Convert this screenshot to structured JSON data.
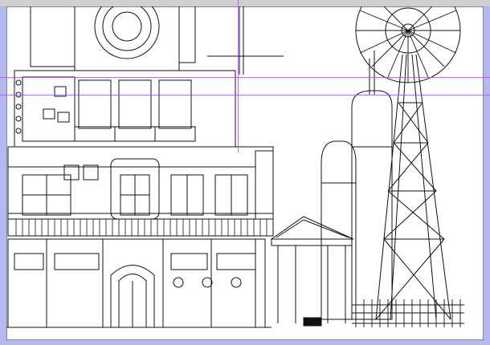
{
  "app": {
    "canvas": {
      "background": "#ffffff",
      "outside": "#b4b8f0",
      "line_color": "#111111",
      "guide_color": "#a75ad9"
    }
  }
}
